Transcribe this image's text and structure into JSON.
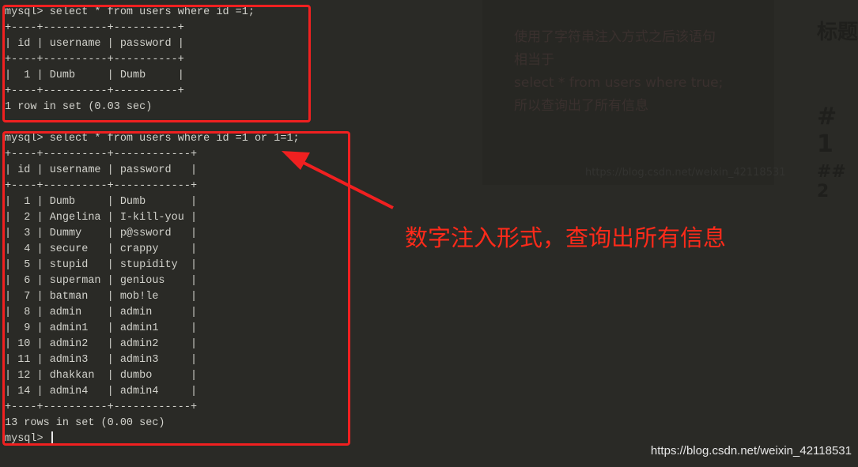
{
  "terminal": {
    "lines": [
      "mysql> select * from users where id =1;",
      "+----+----------+----------+",
      "| id | username | password |",
      "+----+----------+----------+",
      "|  1 | Dumb     | Dumb     |",
      "+----+----------+----------+",
      "1 row in set (0.03 sec)",
      "",
      "mysql> select * from users where id =1 or 1=1;",
      "+----+----------+------------+",
      "| id | username | password   |",
      "+----+----------+------------+",
      "|  1 | Dumb     | Dumb       |",
      "|  2 | Angelina | I-kill-you |",
      "|  3 | Dummy    | p@ssword   |",
      "|  4 | secure   | crappy     |",
      "|  5 | stupid   | stupidity  |",
      "|  6 | superman | genious    |",
      "|  7 | batman   | mob!le     |",
      "|  8 | admin    | admin      |",
      "|  9 | admin1   | admin1     |",
      "| 10 | admin2   | admin2     |",
      "| 11 | admin3   | admin3     |",
      "| 12 | dhakkan  | dumbo      |",
      "| 14 | admin4   | admin4     |",
      "+----+----------+------------+",
      "13 rows in set (0.00 sec)",
      ""
    ],
    "prompt": "mysql> "
  },
  "annotation": {
    "text": "数字注入形式，查询出所有信息",
    "color": "#ff2a1a"
  },
  "background": {
    "panel_lines": [
      "使用了字符串注入方式之后该语句",
      "相当于",
      "select * from users where true;",
      "所以查询出了所有信息"
    ],
    "panel_watermark": "https://blog.csdn.net/weixin_42118531",
    "right_heading": "标题",
    "right_h1": "# 1",
    "right_h2": "## 2"
  },
  "watermark": "https://blog.csdn.net/weixin_42118531"
}
